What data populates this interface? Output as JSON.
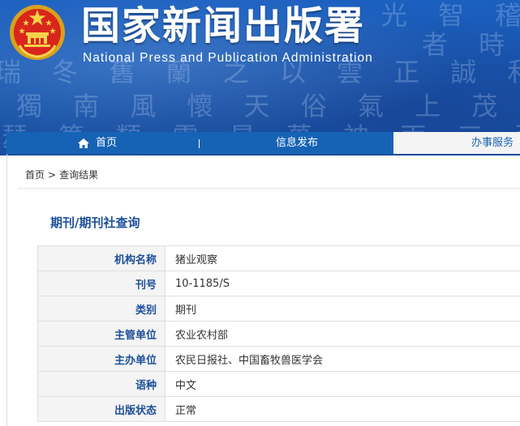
{
  "header": {
    "title": "国家新闻出版署",
    "subtitle": "National Press and Publication Administration",
    "emblem_icon": "national-emblem-icon",
    "background_color": "#1a56ad"
  },
  "nav": {
    "items": [
      {
        "label": "首页",
        "icon": "home-icon"
      },
      {
        "label": "信息发布"
      },
      {
        "label": "办事服务"
      }
    ],
    "bar_color": "#1663b6"
  },
  "breadcrumb": {
    "home": "首页",
    "separator": ">",
    "current": "查询结果"
  },
  "section": {
    "title": "期刊/期刊社查询"
  },
  "details": {
    "rows": [
      {
        "label": "机构名称",
        "value": "猪业观察"
      },
      {
        "label": "刊号",
        "value": "10-1185/S"
      },
      {
        "label": "类别",
        "value": "期刊"
      },
      {
        "label": "主管单位",
        "value": "农业农村部"
      },
      {
        "label": "主办单位",
        "value": "农民日报社、中国畜牧兽医学会"
      },
      {
        "label": "语种",
        "value": "中文"
      },
      {
        "label": "出版状态",
        "value": "正常"
      }
    ],
    "label_color": "#1d4f9a"
  }
}
